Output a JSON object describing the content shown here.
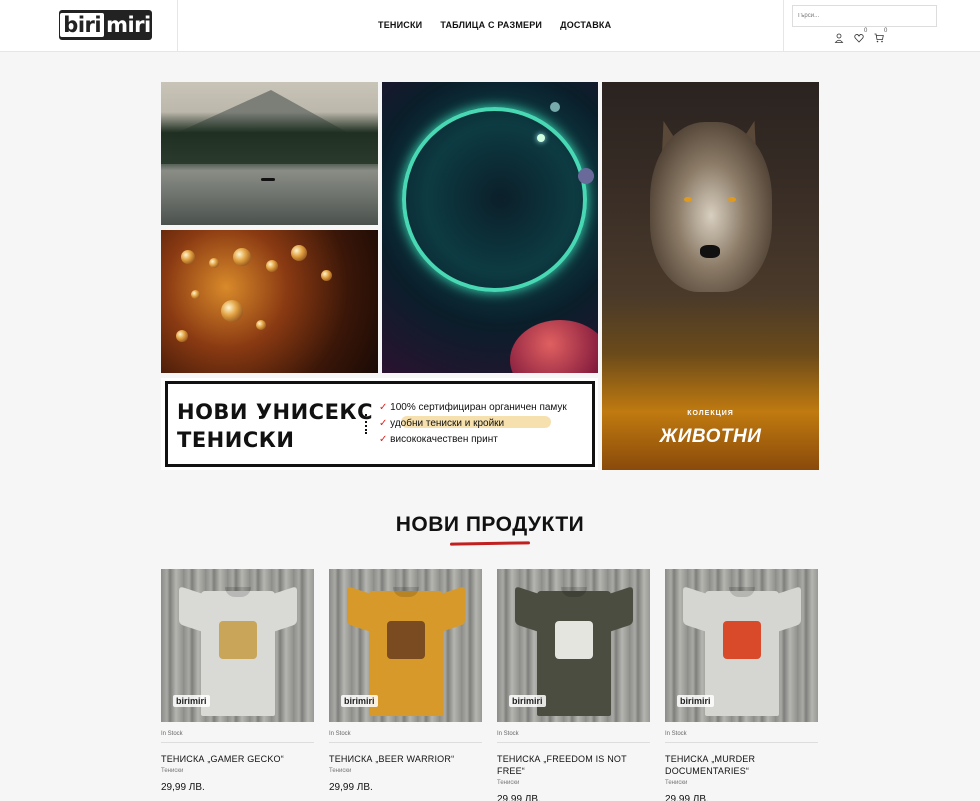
{
  "header": {
    "logo_text_a": "biri",
    "logo_text_b": "miri",
    "nav": [
      "ТЕНИСКИ",
      "ТАБЛИЦА С РАЗМЕРИ",
      "ДОСТАВКА"
    ],
    "search_placeholder": "Търси...",
    "wishlist_count": "0",
    "cart_count": "0"
  },
  "banner": {
    "unisex_line1": "НОВИ УНИСЕКС",
    "unisex_line2": "ТЕНИСКИ",
    "features": [
      "100% сертифициран органичен памук",
      "удобни тениски и кройки",
      "висококачествен принт"
    ],
    "collection_label": "КОЛЕКЦИЯ",
    "collection_title": "ЖИВОТНИ"
  },
  "section_title": "НОВИ ПРОДУКТИ",
  "products": [
    {
      "stock": "In Stock",
      "name": "ТЕНИСКА „GAMER GECKO“",
      "category": "Тениски",
      "price": "29,99 ЛВ.",
      "shirt_color": "#d9d9d6",
      "print_color": "#c9a55a",
      "watermark": "birimiri"
    },
    {
      "stock": "In Stock",
      "name": "ТЕНИСКА „BEER WARRIOR“",
      "category": "Тениски",
      "price": "29,99 ЛВ.",
      "shirt_color": "#d79a2a",
      "print_color": "#7a4a20",
      "watermark": "birimiri"
    },
    {
      "stock": "In Stock",
      "name": "ТЕНИСКА „FREEDOM IS NOT FREE“",
      "category": "Тениски",
      "price": "29,99 ЛВ.",
      "shirt_color": "#4a4d40",
      "print_color": "#e5e5e0",
      "watermark": "birimiri"
    },
    {
      "stock": "In Stock",
      "name": "ТЕНИСКА „MURDER DOCUMENTARIES“",
      "category": "Тениски",
      "price": "29,99 ЛВ.",
      "shirt_color": "#d5d5d2",
      "print_color": "#d94a2a",
      "watermark": "birimiri"
    }
  ]
}
